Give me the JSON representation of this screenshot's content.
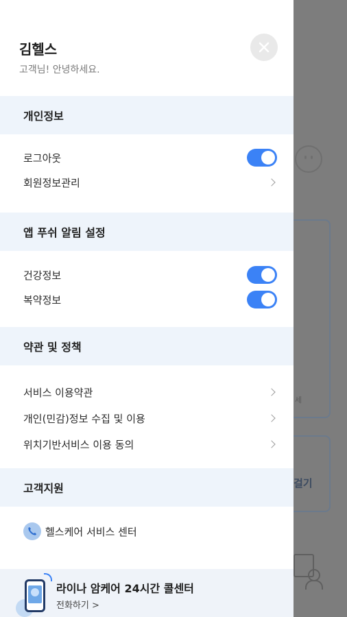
{
  "drawer": {
    "user_name": "김헬스",
    "greeting": "고객님! 안녕하세요."
  },
  "sections": {
    "personal": {
      "title": "개인정보",
      "logout_label": "로그아웃",
      "logout_toggle": true,
      "member_manage_label": "회원정보관리"
    },
    "push": {
      "title": "앱 푸쉬 알림 설정",
      "health_label": "건강정보",
      "health_toggle": true,
      "medication_label": "복약정보",
      "medication_toggle": true
    },
    "terms": {
      "title": "약관 및 정책",
      "items": [
        "서비스 이용약관",
        "개인(민감)정보 수집 및 이용",
        "위치기반서비스 이용 동의"
      ]
    },
    "support": {
      "title": "고객지원",
      "center_label": "헬스케어 서비스 센터"
    }
  },
  "callcenter": {
    "title": "라이나 암케어 24시간 콜센터",
    "cta": "전화하기 >"
  },
  "background": {
    "card_action_label": "걸기",
    "card_text": "세"
  },
  "colors": {
    "accent": "#3b82f6",
    "section_bg": "#eef4fb",
    "overlay": "#7d7d7d"
  }
}
